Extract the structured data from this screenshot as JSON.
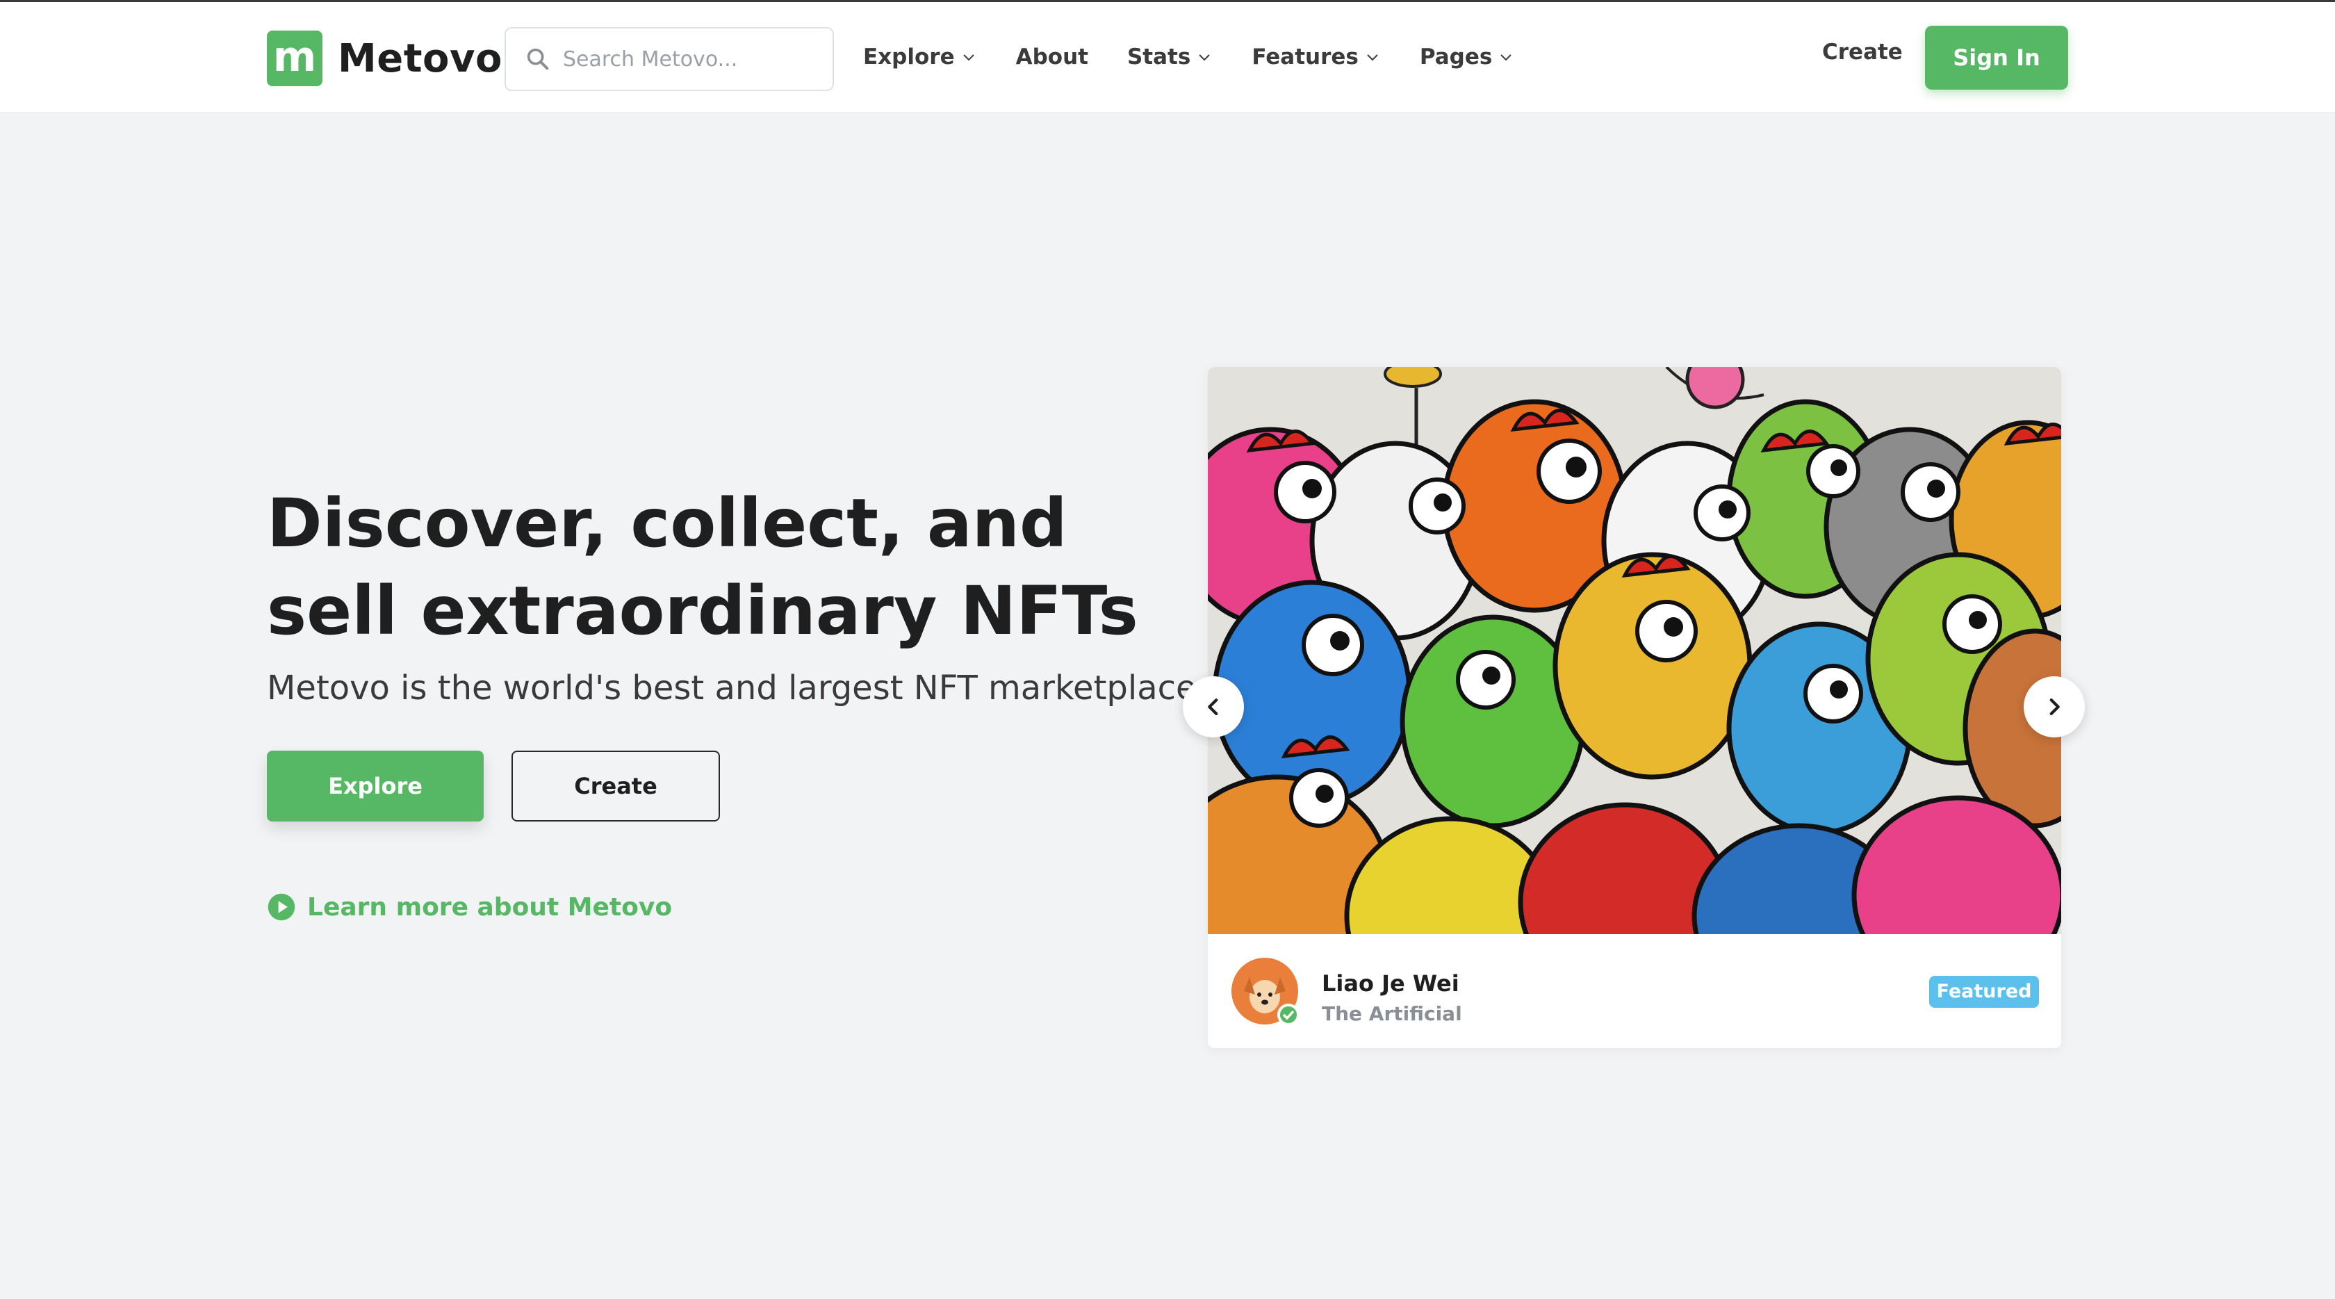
{
  "brand": {
    "logo_letter": "m",
    "name": "Metovo",
    "accent": "#56b865"
  },
  "search": {
    "placeholder": "Search Metovo..."
  },
  "nav": {
    "items": [
      {
        "label": "Explore",
        "has_dropdown": true
      },
      {
        "label": "About",
        "has_dropdown": false
      },
      {
        "label": "Stats",
        "has_dropdown": true
      },
      {
        "label": "Features",
        "has_dropdown": true
      },
      {
        "label": "Pages",
        "has_dropdown": true
      }
    ],
    "create_label": "Create",
    "signin_label": "Sign In"
  },
  "hero": {
    "title": "Discover, collect, and sell extraordinary NFTs",
    "subtitle": "Metovo is the world's best and largest NFT marketplace",
    "explore_label": "Explore",
    "create_label": "Create",
    "learn_more_label": "Learn more about Metovo"
  },
  "featured_card": {
    "author": "Liao Je Wei",
    "collection": "The Artificial",
    "badge": "Featured",
    "badge_color": "#5bc0eb",
    "verified_color": "#56b865"
  },
  "icons": {
    "search": "search-icon",
    "dropdown": "chevron-down-icon",
    "play": "play-circle-icon",
    "prev": "chevron-left-icon",
    "next": "chevron-right-icon"
  }
}
